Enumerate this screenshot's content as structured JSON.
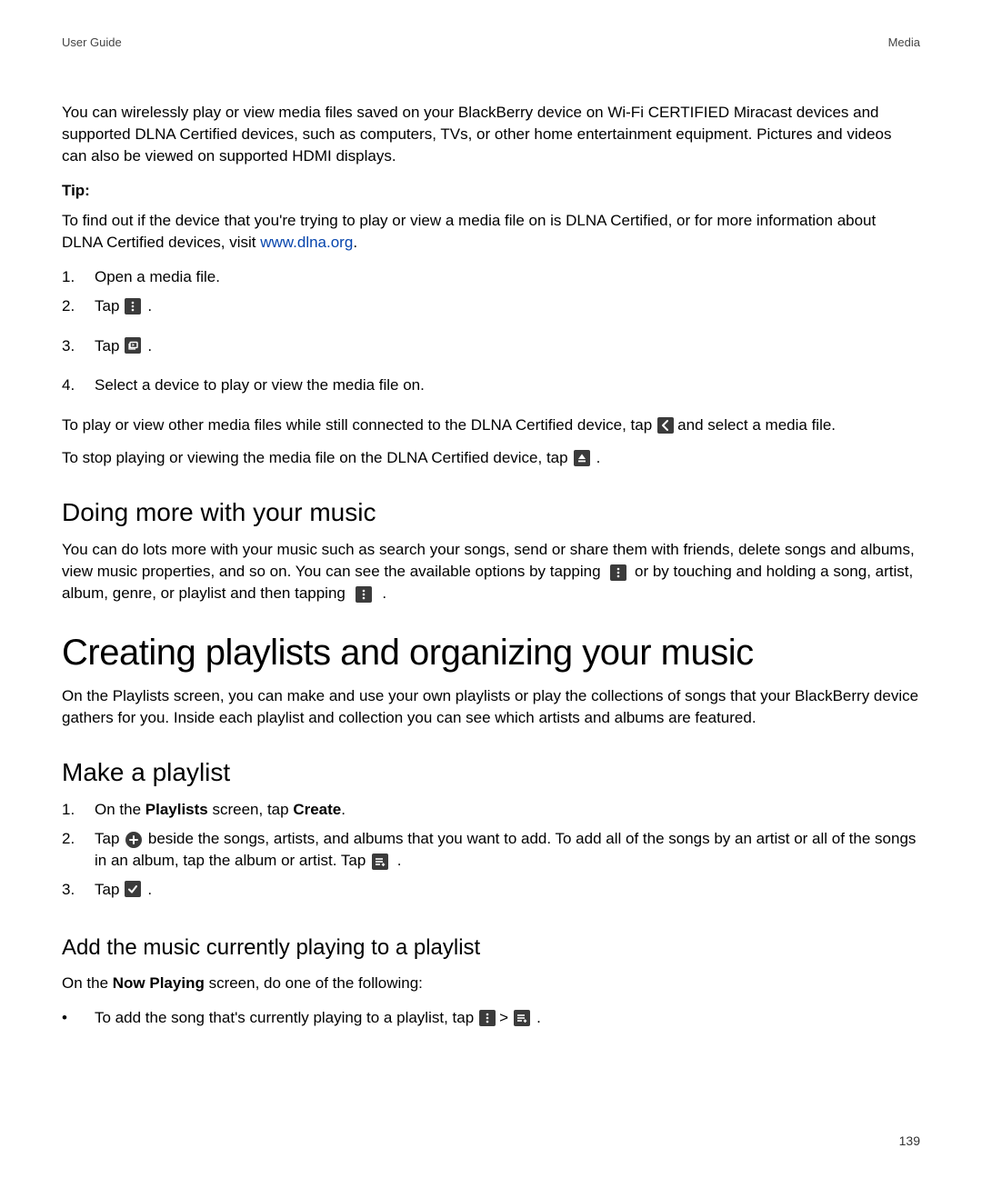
{
  "header": {
    "left": "User Guide",
    "right": "Media"
  },
  "intro": {
    "p1": "You can wirelessly play or view media files saved on your BlackBerry device on Wi-Fi CERTIFIED Miracast devices and supported DLNA Certified devices, such as computers, TVs, or other home entertainment equipment. Pictures and videos can also be viewed on supported HDMI displays.",
    "tip_label": "Tip:",
    "tip_pre": "To find out if the device that you're trying to play or view a media file on is DLNA Certified, or for more information about DLNA Certified devices, visit ",
    "tip_link": "www.dlna.org",
    "tip_post": "."
  },
  "steps1": {
    "s1": "Open a media file.",
    "s2_pre": "Tap ",
    "s3_pre": "Tap ",
    "s4": "Select a device to play or view the media file on."
  },
  "after1": {
    "a_pre": "To play or view other media files while still connected to the DLNA Certified device, tap ",
    "a_post": " and select a media file.",
    "b_pre": "To stop playing or viewing the media file on the DLNA Certified device, tap "
  },
  "more_music": {
    "h": "Doing more with your music",
    "p_pre": "You can do lots more with your music such as search your songs, send or share them with friends, delete songs and albums, view music properties, and so on. You can see the available options by tapping ",
    "p_mid": " or by touching and holding a song, artist, album, genre, or playlist and then tapping "
  },
  "h1": "Creating playlists and organizing your music",
  "h1_p": "On the Playlists screen, you can make and use your own playlists or play the collections of songs that your BlackBerry device gathers for you. Inside each playlist and collection you can see which artists and albums are featured.",
  "make": {
    "h": "Make a playlist",
    "s1_pre": "On the ",
    "s1_b1": "Playlists",
    "s1_mid": " screen, tap ",
    "s1_b2": "Create",
    "s1_post": ".",
    "s2_pre": "Tap ",
    "s2_mid": " beside the songs, artists, and albums that you want to add. To add all of the songs by an artist or all of the songs in an album, tap the album or artist. Tap ",
    "s3_pre": "Tap "
  },
  "add_current": {
    "h": "Add the music currently playing to a playlist",
    "p_pre": "On the ",
    "p_b": "Now Playing",
    "p_post": " screen, do one of the following:",
    "b1_pre": "To add the song that's currently playing to a playlist, tap ",
    "b1_sep": " > "
  },
  "page_number": "139",
  "numbers": {
    "n1": "1.",
    "n2": "2.",
    "n3": "3.",
    "n4": "4."
  },
  "dot": "."
}
